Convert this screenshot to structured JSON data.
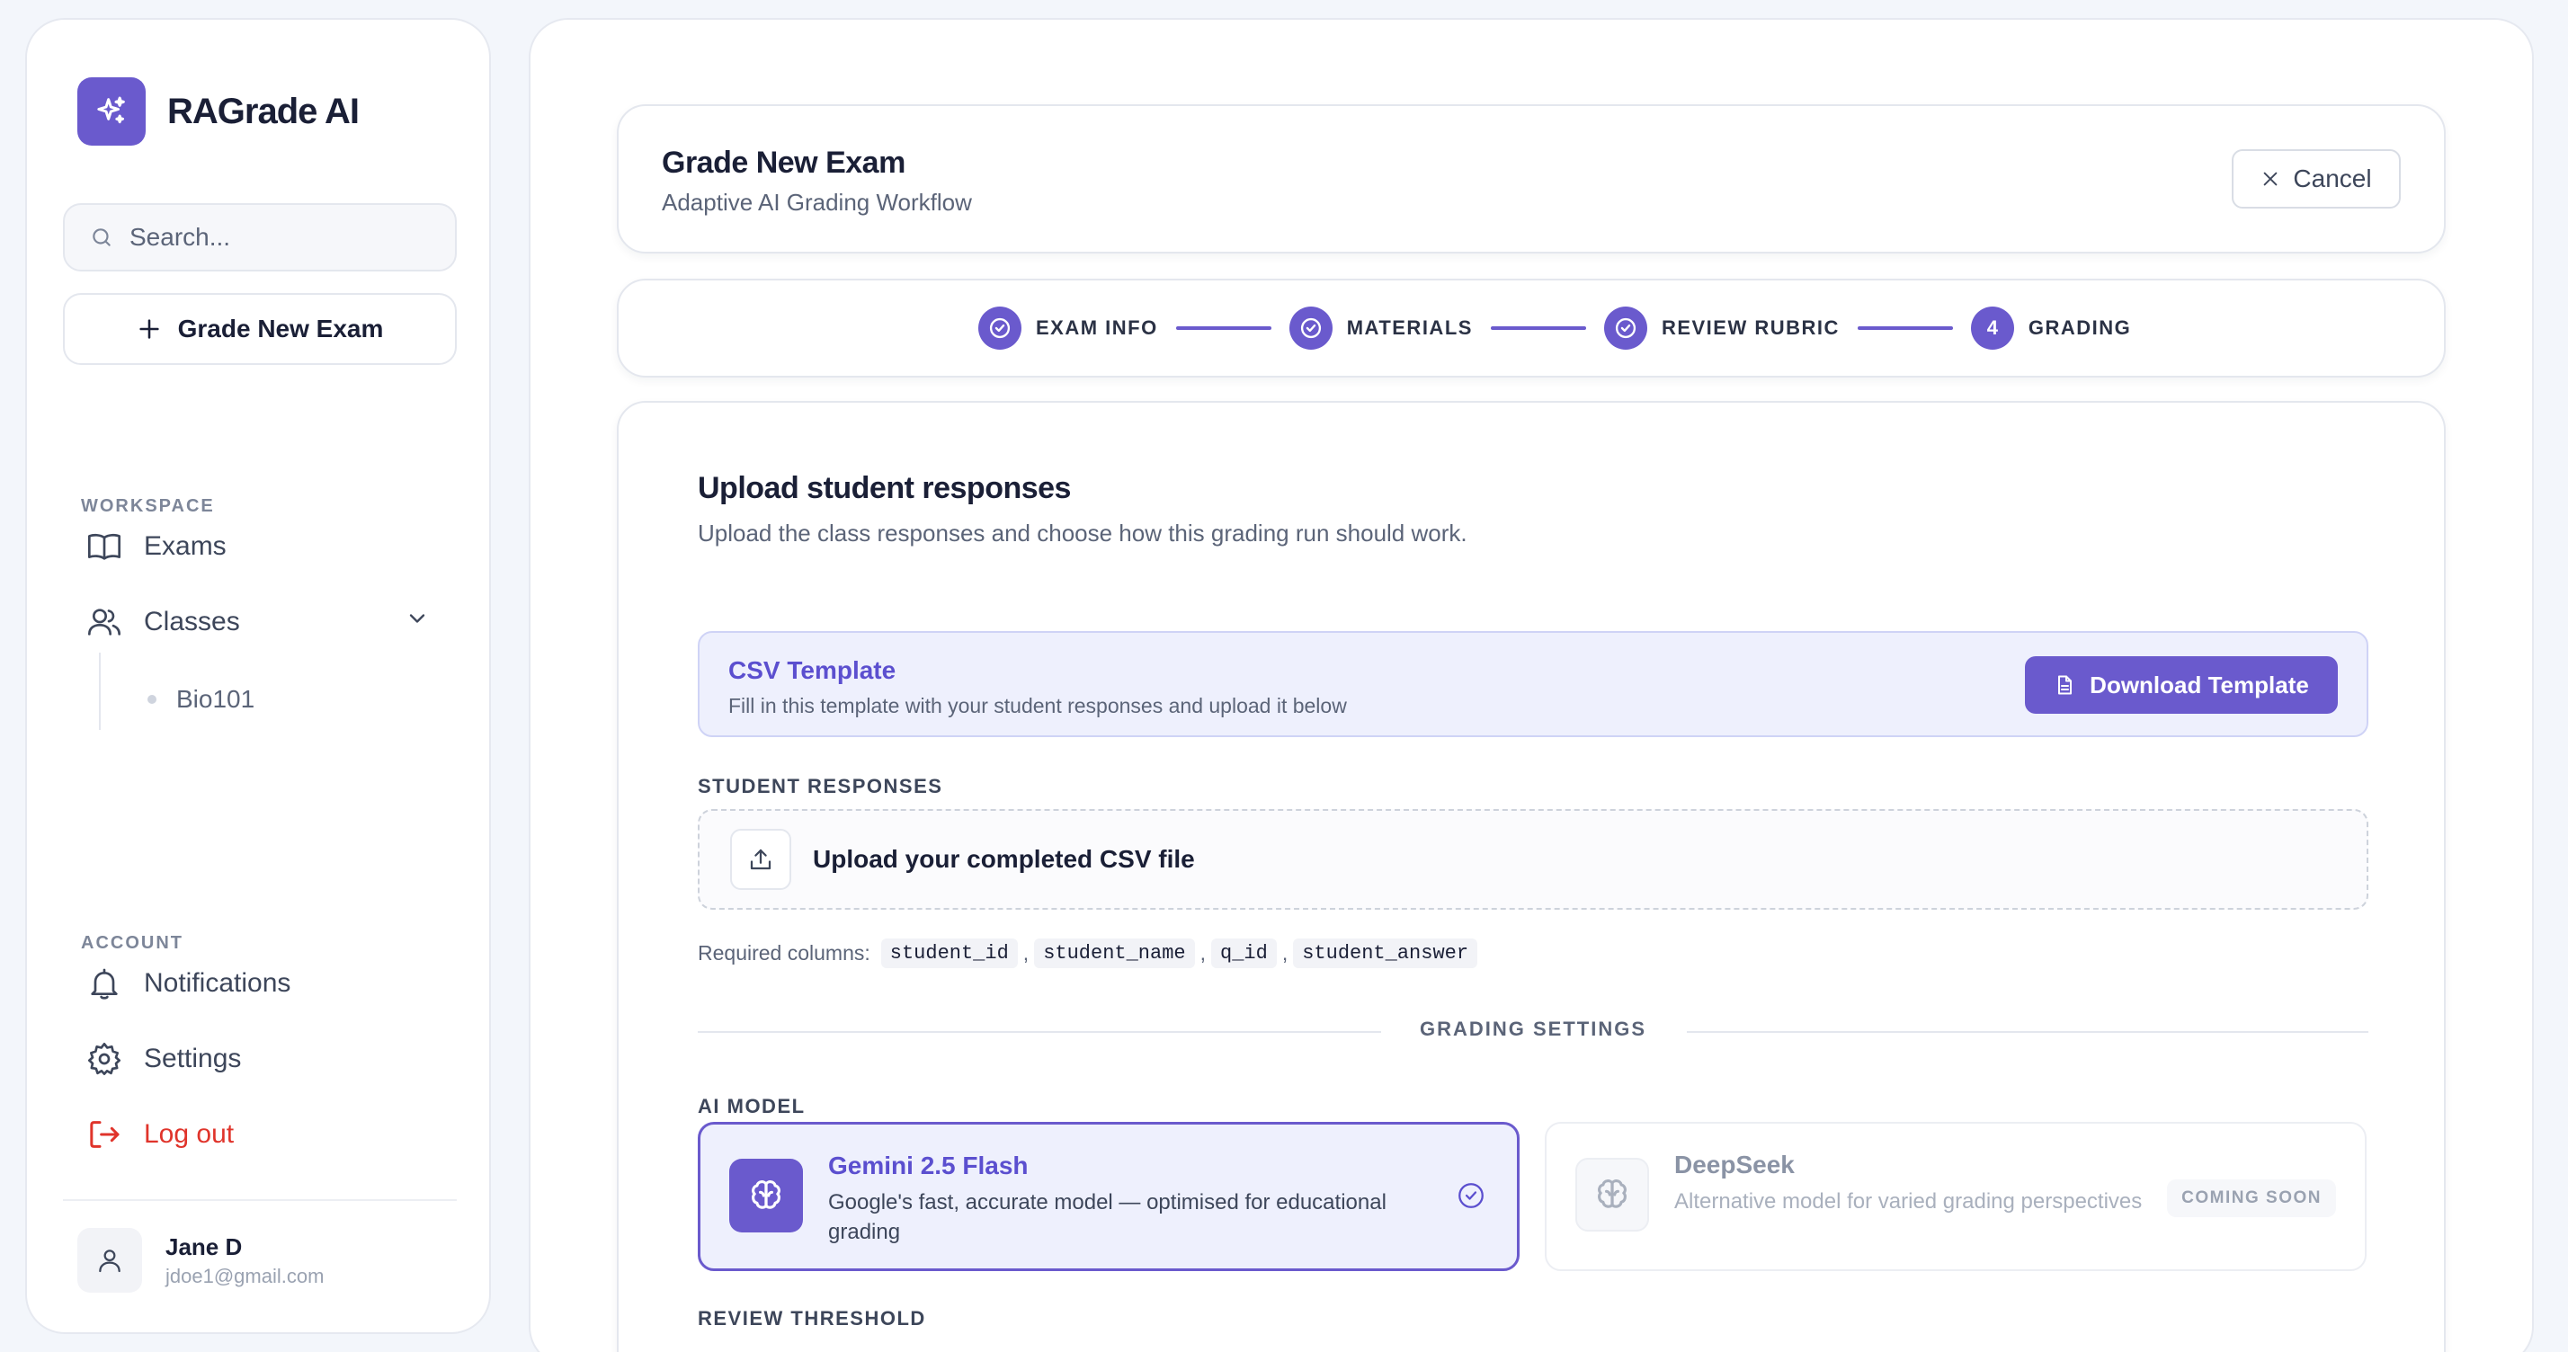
{
  "app": {
    "name": "RAGrade AI"
  },
  "sidebar": {
    "search_placeholder": "Search...",
    "new_exam_label": "Grade New Exam",
    "workspace_label": "WORKSPACE",
    "items": [
      {
        "label": "Exams",
        "icon": "book-open-icon"
      },
      {
        "label": "Classes",
        "icon": "users-icon"
      }
    ],
    "classes_sub": [
      {
        "label": "Bio101"
      }
    ],
    "account_label": "ACCOUNT",
    "account_items": [
      {
        "label": "Notifications",
        "icon": "bell-icon"
      },
      {
        "label": "Settings",
        "icon": "gear-icon"
      },
      {
        "label": "Log out",
        "icon": "logout-icon"
      }
    ],
    "user": {
      "name": "Jane D",
      "email": "jdoe1@gmail.com"
    }
  },
  "header": {
    "title": "Grade New Exam",
    "subtitle": "Adaptive AI Grading Workflow",
    "cancel_label": "Cancel"
  },
  "stepper": {
    "steps": [
      {
        "label": "EXAM INFO",
        "status": "done"
      },
      {
        "label": "MATERIALS",
        "status": "done"
      },
      {
        "label": "REVIEW RUBRIC",
        "status": "done"
      },
      {
        "label": "GRADING",
        "status": "current",
        "number": "4"
      }
    ]
  },
  "upload": {
    "title": "Upload student responses",
    "subtitle": "Upload the class responses and choose how this grading run should work.",
    "template": {
      "title": "CSV Template",
      "description": "Fill in this template with your student responses and upload it below",
      "button_label": "Download Template"
    },
    "responses_label": "STUDENT RESPONSES",
    "dropzone_label": "Upload your completed CSV file",
    "required_intro": "Required columns:",
    "required_columns": [
      "student_id",
      "student_name",
      "q_id",
      "student_answer"
    ],
    "required_sep": ","
  },
  "settings": {
    "divider_label": "GRADING SETTINGS",
    "ai_model_label": "AI MODEL",
    "models": [
      {
        "name": "Gemini 2.5 Flash",
        "description": "Google's fast, accurate model — optimised for educational grading",
        "selected": true
      },
      {
        "name": "DeepSeek",
        "description": "Alternative model for varied grading perspectives",
        "badge": "COMING SOON"
      }
    ],
    "review_threshold_label": "REVIEW THRESHOLD"
  },
  "colors": {
    "accent": "#6a5acd",
    "accent_text": "#5b4fcf",
    "danger": "#e0342b",
    "template_bg": "#eef0fd"
  }
}
